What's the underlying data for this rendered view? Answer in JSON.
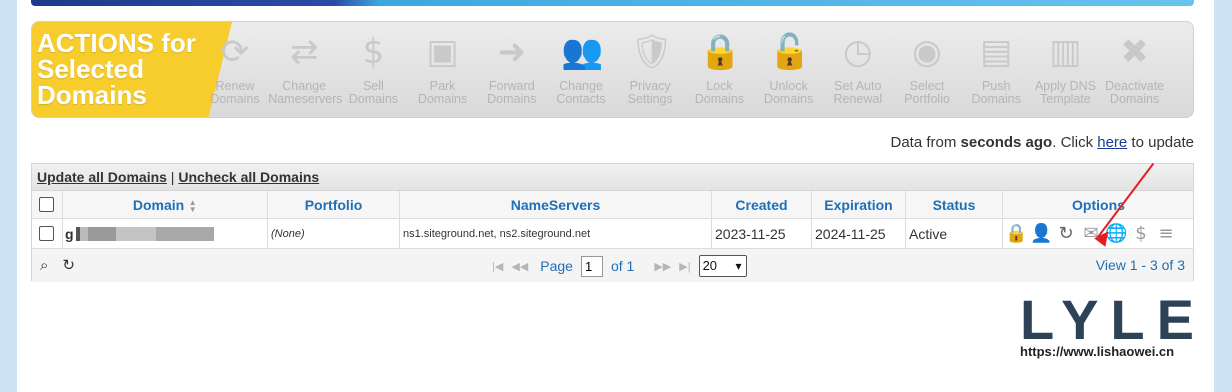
{
  "actions": {
    "label": "ACTIONS for Selected Domains",
    "items": [
      {
        "label": "Renew\nDomains",
        "icon": "renew-icon",
        "glyph": "⟳"
      },
      {
        "label": "Change\nNameservers",
        "icon": "swap-arrows-icon",
        "glyph": "⇄"
      },
      {
        "label": "Sell\nDomains",
        "icon": "dollar-icon",
        "glyph": "$"
      },
      {
        "label": "Park\nDomains",
        "icon": "park-icon",
        "glyph": "▣"
      },
      {
        "label": "Forward\nDomains",
        "icon": "forward-arrow-icon",
        "glyph": "➜"
      },
      {
        "label": "Change\nContacts",
        "icon": "contacts-icon",
        "glyph": "👥"
      },
      {
        "label": "Privacy\nSettings",
        "icon": "privacy-icon",
        "glyph": "🛡"
      },
      {
        "label": "Lock\nDomains",
        "icon": "lock-icon",
        "glyph": "🔒"
      },
      {
        "label": "Unlock\nDomains",
        "icon": "unlock-icon",
        "glyph": "🔓"
      },
      {
        "label": "Set Auto\nRenewal",
        "icon": "clock-icon",
        "glyph": "◷"
      },
      {
        "label": "Select\nPortfolio",
        "icon": "portfolio-icon",
        "glyph": "◉"
      },
      {
        "label": "Push\nDomains",
        "icon": "push-icon",
        "glyph": "▤"
      },
      {
        "label": "Apply DNS\nTemplate",
        "icon": "dns-template-icon",
        "glyph": "▥"
      },
      {
        "label": "Deactivate\nDomains",
        "icon": "deactivate-icon",
        "glyph": "✖"
      }
    ]
  },
  "update_notice": {
    "prefix": "Data from ",
    "emphasis": "seconds ago",
    "middle": ". Click ",
    "link": "here",
    "suffix": " to update"
  },
  "grid": {
    "toolbar": {
      "update_all": "Update all Domains",
      "separator": " | ",
      "uncheck_all": "Uncheck all Domains"
    },
    "columns": [
      "Domain",
      "Portfolio",
      "NameServers",
      "Created",
      "Expiration",
      "Status",
      "Options"
    ],
    "sort_indicator": "▲▼",
    "rows": [
      {
        "domain_visible": "g",
        "portfolio": "(None)",
        "nameservers": "ns1.siteground.net, ns2.siteground.net",
        "created": "2023-11-25",
        "expiration": "2024-11-25",
        "status": "Active"
      }
    ],
    "option_icons": [
      {
        "name": "lock-option-icon",
        "glyph": "🔒",
        "color": "#e0a100"
      },
      {
        "name": "contact-option-icon",
        "glyph": "👤",
        "color": "#e0a100"
      },
      {
        "name": "renew-option-icon",
        "glyph": "↻",
        "color": "#666666"
      },
      {
        "name": "email-option-icon",
        "glyph": "✉",
        "color": "#999999"
      },
      {
        "name": "dns-globe-option-icon",
        "glyph": "🌐",
        "color": "#1e6fd9"
      },
      {
        "name": "sell-option-icon",
        "glyph": "$",
        "color": "#999999"
      },
      {
        "name": "database-option-icon",
        "glyph": "≡",
        "color": "#999999"
      }
    ],
    "pager": {
      "search_icon": "search-icon",
      "refresh_icon": "refresh-icon",
      "page_label": "Page",
      "page_value": "1",
      "of_label": "of 1",
      "rows_per_page": "20",
      "view_text": "View 1 - 3 of 3"
    }
  },
  "watermark": {
    "logo": "LYLE",
    "url": "https://www.lishaowei.cn"
  },
  "colors": {
    "accent_yellow": "#f7cd2e",
    "link_blue": "#1f6fb8",
    "arrow_red": "#e31e24"
  }
}
